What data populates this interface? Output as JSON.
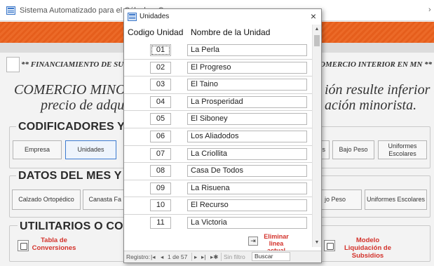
{
  "main_window": {
    "title": "Sistema Automatizado para el Cálculo y Con",
    "close_edge": "›",
    "financ_left": "** FINANCIAMIENTO DE SUBSI",
    "financ_right": "OMERCIO INTERIOR EN MN **",
    "comercio_title": "COMERCIO MINORIS",
    "precio_line": "precio de adquisi",
    "resulte_line": "ión resulte inferior al",
    "minorista_line": "ación minorista."
  },
  "codificadores": {
    "heading": "CODIFICADORES Y ACT",
    "buttons": [
      {
        "label": "Empresa"
      },
      {
        "label": "Unidades"
      },
      {
        "label": "s"
      },
      {
        "label": "Bajo Peso"
      },
      {
        "label": "Uniformes Escolares"
      }
    ]
  },
  "datos": {
    "heading": "DATOS DEL MES Y REP",
    "buttons": [
      {
        "label": "Calzado Ortopédico"
      },
      {
        "label": "Canasta Fa"
      },
      {
        "label": "jo Peso"
      },
      {
        "label": "Uniformes Escolares"
      }
    ]
  },
  "utilitarios": {
    "heading": "UTILITARIOS O COMPLE",
    "tabla_label": "Tabla de Conversiones",
    "modelo_label": "Modelo Liquidación de Subsidios"
  },
  "popup": {
    "title": "Unidades",
    "close_glyph": "×",
    "col_codigo": "Codigo Unidad",
    "col_nombre": "Nombre de la Unidad",
    "rows": [
      {
        "code": "01",
        "name": "La Perla"
      },
      {
        "code": "02",
        "name": "El Progreso"
      },
      {
        "code": "03",
        "name": "El Taino"
      },
      {
        "code": "04",
        "name": "La Prosperidad"
      },
      {
        "code": "05",
        "name": "El Siboney"
      },
      {
        "code": "06",
        "name": "Los Aliadodos"
      },
      {
        "code": "07",
        "name": "La Criollita"
      },
      {
        "code": "08",
        "name": "Casa De Todos"
      },
      {
        "code": "09",
        "name": "La Risuena"
      },
      {
        "code": "10",
        "name": "El Recurso"
      },
      {
        "code": "11",
        "name": "La Victoria"
      }
    ],
    "delete_label": "Eliminar linea actual",
    "nav": {
      "registro_label": "Registro:",
      "first": "|◂",
      "prev": "◂",
      "position": "1 de 57",
      "next": "▸",
      "last": "▸|",
      "new": "▸✱",
      "filter": "Sin filtro",
      "search": "Buscar"
    }
  },
  "colors": {
    "accent_orange": "#ec6a28",
    "link_red": "#d3322b",
    "active_blue": "#3c7bd0"
  },
  "icons": [
    "form-icon",
    "close-icon",
    "scroll-up-icon",
    "scroll-down-icon",
    "delete-row-icon",
    "report-icon"
  ]
}
